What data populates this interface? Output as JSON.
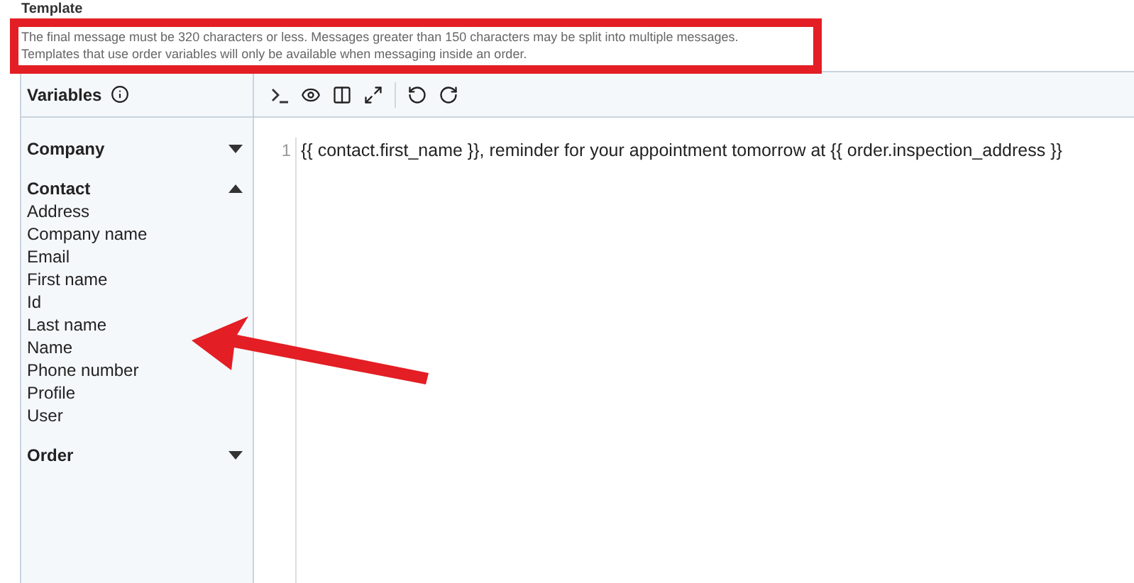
{
  "section": {
    "title": "Template",
    "help": [
      "The final message must be 320 characters or less. Messages greater than 150 characters may be split into multiple messages.",
      "Templates that use order variables will only be available when messaging inside an order."
    ]
  },
  "sidebar": {
    "title": "Variables",
    "groups": [
      {
        "label": "Company",
        "expanded": false
      },
      {
        "label": "Contact",
        "expanded": true,
        "items": [
          "Address",
          "Company name",
          "Email",
          "First name",
          "Id",
          "Last name",
          "Name",
          "Phone number",
          "Profile",
          "User"
        ]
      },
      {
        "label": "Order",
        "expanded": false
      }
    ]
  },
  "editor": {
    "lines": [
      {
        "number": "1",
        "text": "{{ contact.first_name }}, reminder for your appointment tomorrow at {{ order.inspection_address }}"
      }
    ]
  }
}
